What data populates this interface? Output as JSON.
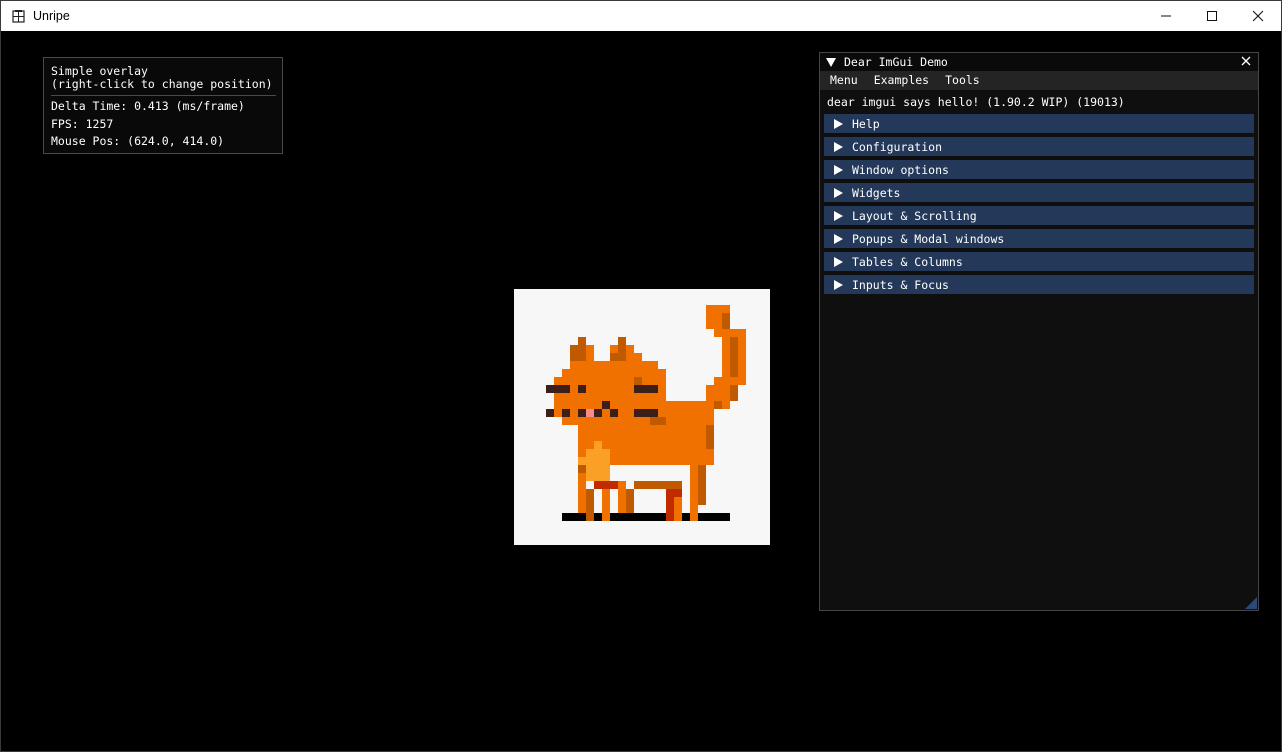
{
  "window": {
    "title": "Unripe",
    "icon": "app-grid-icon",
    "controls": [
      "minimize-icon",
      "maximize-icon",
      "close-icon"
    ]
  },
  "overlay": {
    "line1": "Simple overlay",
    "line2": "(right-click to change position)",
    "delta_time": "Delta Time: 0.413 (ms/frame)",
    "fps": "FPS: 1257",
    "mouse_pos": "Mouse Pos: (624.0, 414.0)"
  },
  "demo": {
    "title": "Dear ImGui Demo",
    "menu": [
      "Menu",
      "Examples",
      "Tools"
    ],
    "hello": "dear imgui says hello! (1.90.2 WIP) (19013)",
    "headers": [
      "Help",
      "Configuration",
      "Window options",
      "Widgets",
      "Layout & Scrolling",
      "Popups & Modal windows",
      "Tables & Columns",
      "Inputs & Focus"
    ]
  },
  "colors": {
    "background": "#000000",
    "header": "#24395a",
    "cat_orange": "#f07000",
    "cat_dark": "#c05a00"
  }
}
